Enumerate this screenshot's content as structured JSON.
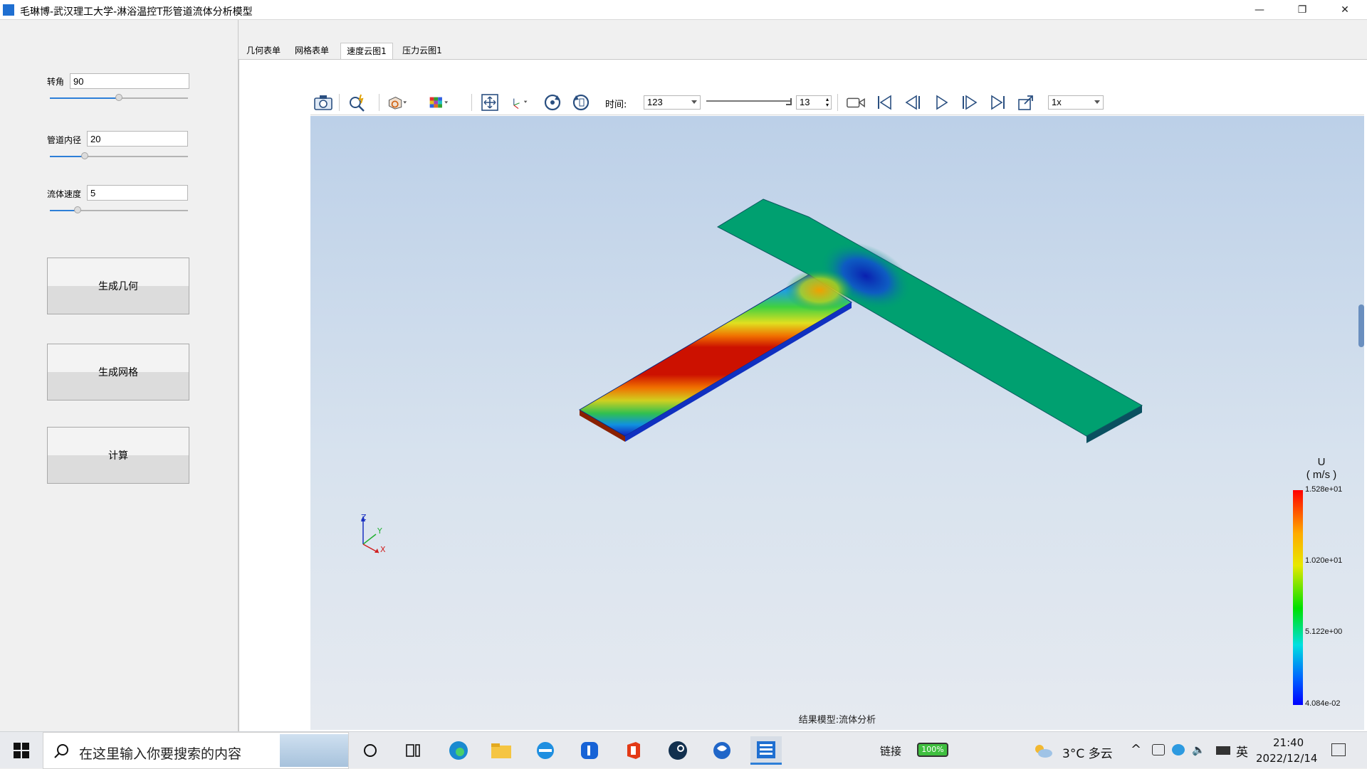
{
  "window": {
    "title": "毛琳博-武汉理工大学-淋浴温控T形管道流体分析模型",
    "minimize": "—",
    "restore": "❐",
    "close": "✕"
  },
  "params": {
    "angle": {
      "label": "转角",
      "value": "90",
      "level": 0.5
    },
    "diameter": {
      "label": "管道内径",
      "value": "20",
      "level": 0.25
    },
    "velocity": {
      "label": "流体速度",
      "value": "5",
      "level": 0.2
    }
  },
  "buttons": {
    "geometry": "生成几何",
    "mesh": "生成网格",
    "compute": "计算"
  },
  "tabs": [
    {
      "label": "几何表单",
      "active": false
    },
    {
      "label": "网格表单",
      "active": false
    },
    {
      "label": "速度云图1",
      "active": true
    },
    {
      "label": "压力云图1",
      "active": false
    }
  ],
  "toolbar": {
    "time_label": "时间:",
    "time_value": "123",
    "step_value": "13",
    "speed_value": "1x"
  },
  "viewport": {
    "status": "结果模型:流体分析",
    "axes": {
      "z": "Z",
      "y": "Y",
      "x": "X"
    }
  },
  "legend": {
    "variable": "U",
    "unit": "( m/s )",
    "ticks": [
      "1.528e+01",
      "1.020e+01",
      "5.122e+00",
      "4.084e-02"
    ]
  },
  "taskbar": {
    "search_placeholder": "在这里输入你要搜索的内容",
    "network_label": "链接",
    "battery": "100%",
    "weather": "3°C 多云",
    "ime": "英",
    "time": "21:40",
    "date": "2022/12/14"
  },
  "colors": {
    "accent": "#2d7fd8",
    "velocity_high": "#cc1100",
    "velocity_mid": "#00a070",
    "velocity_low": "#0022cc"
  }
}
